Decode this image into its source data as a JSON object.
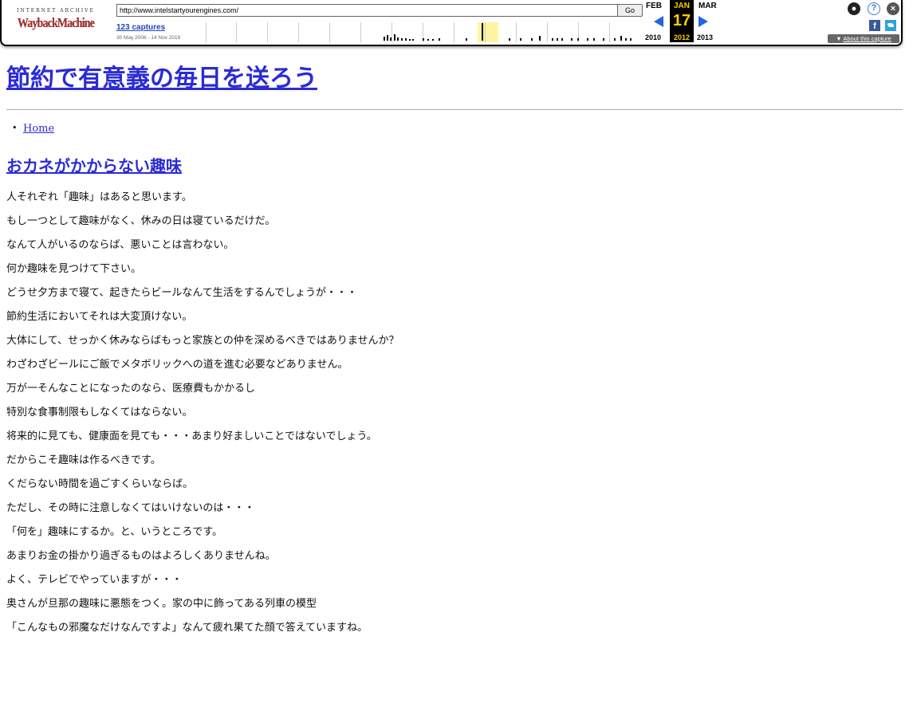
{
  "wayback": {
    "logo_top": "INTERNET ARCHIVE",
    "logo_main": "WaybackMachine",
    "url": "http://www.intelstartyourengines.com/",
    "go_label": "Go",
    "captures": "123 captures",
    "date_range": "30 May 2006 - 14 Nov 2019",
    "prev_month": "FEB",
    "cur_month": "JAN",
    "next_month": "MAR",
    "cur_day": "17",
    "prev_year": "2010",
    "cur_year": "2012",
    "next_year": "2013",
    "about": "About this capture",
    "icons": [
      "user-icon",
      "help-icon",
      "close-icon",
      "facebook-icon",
      "twitter-icon"
    ]
  },
  "site": {
    "title": "節約で有意義の毎日を送ろう",
    "nav": [
      "Home"
    ]
  },
  "post": {
    "title": "おカネがかからない趣味",
    "paragraphs": [
      "人それぞれ「趣味」はあると思います。",
      "もし一つとして趣味がなく、休みの日は寝ているだけだ。",
      "なんて人がいるのならば、悪いことは言わない。",
      "何か趣味を見つけて下さい。",
      "どうせ夕方まで寝て、起きたらビールなんて生活をするんでしょうが・・・",
      "節約生活においてそれは大変頂けない。",
      "大体にして、せっかく休みならばもっと家族との仲を深めるべきではありませんか？",
      "わざわざビールにご飯でメタボリックへの道を進む必要などありません。",
      "万が一そんなことになったのなら、医療費もかかるし",
      "特別な食事制限もしなくてはならない。",
      "将来的に見ても、健康面を見ても・・・あまり好ましいことではないでしょう。",
      "だからこそ趣味は作るべきです。",
      "くだらない時間を過ごすくらいならば。",
      "ただし、その時に注意しなくてはいけないのは・・・",
      "「何を」趣味にするか。と、いうところです。",
      "あまりお金の掛かり過ぎるものはよろしくありませんね。",
      "よく、テレビでやっていますが・・・",
      "奥さんが旦那の趣味に悪態をつく。家の中に飾ってある列車の模型",
      "「こんなもの邪魔なだけなんですよ」なんて疲れ果てた顔で答えていますね。"
    ]
  }
}
